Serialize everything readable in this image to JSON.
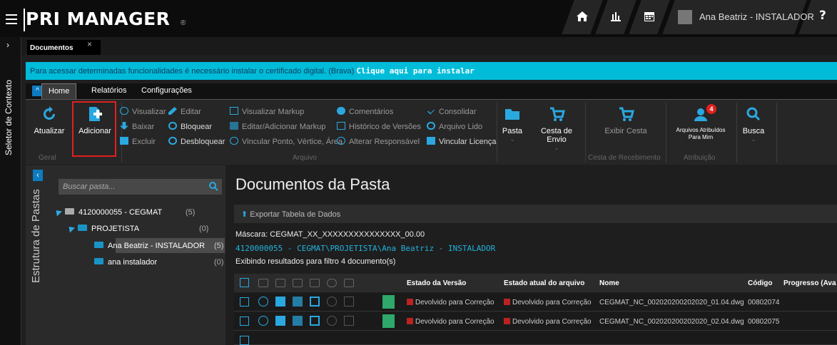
{
  "app": {
    "logo": "PRI MANAGER",
    "reg_mark": "®",
    "user": "Ana Beatriz - INSTALADOR",
    "help": "?"
  },
  "rail": {
    "context_label": "Seletor de Contexto"
  },
  "tabs": [
    {
      "label": "Documentos",
      "close": "×"
    }
  ],
  "banner": {
    "text": "Para acessar determinadas funcionalidades é necessário instalar o certificado digital. (Brava)",
    "link": "Clique aqui para instalar"
  },
  "ribbon_tabs": [
    "Home",
    "Relatórios",
    "Configurações"
  ],
  "ribbon": {
    "refresh": "Atualizar",
    "add": "Adicionar",
    "group_geral": "Geral",
    "visualizar": "Visualizar",
    "baixar": "Baixar",
    "excluir": "Excluir",
    "editar": "Editar",
    "bloquear": "Bloquear",
    "desbloquear": "Desbloquear",
    "visualizar_markup": "Visualizar Markup",
    "editar_markup": "Editar/Adicionar Markup",
    "vincular_ponto": "Vincular Ponto, Vértice, Área",
    "comentarios": "Comentários",
    "historico": "Histórico de Versões",
    "alterar_resp": "Alterar Responsável",
    "consolidar": "Consolidar",
    "arquivo_lido": "Arquivo Lido",
    "vincular_licenca": "Vincular Licença",
    "group_arquivo": "Arquivo",
    "pasta": "Pasta",
    "cesta_envio": "Cesta de Envio",
    "exibir_cesta": "Exibir Cesta",
    "group_cesta": "Cesta de Recebimento",
    "arquivos_atribuidos": "Arquivos Atribuídos Para Mim",
    "badge": "4",
    "group_atrib": "Atribuição",
    "busca": "Busca"
  },
  "left_panel": {
    "title": "Estrutura de Pastas",
    "search_placeholder": "Buscar pasta...",
    "tree": [
      {
        "label": "4120000055 - CEGMAT",
        "count": "(5)"
      },
      {
        "label": "PROJETISTA",
        "count": "(0)"
      },
      {
        "label": "Ana Beatriz - INSTALADOR",
        "count": "(5)"
      },
      {
        "label": "ana instalador",
        "count": "(0)"
      }
    ]
  },
  "main": {
    "title": "Documentos da Pasta",
    "export": "Exportar Tabela de Dados",
    "mask": "Máscara: CEGMAT_XX_XXXXXXXXXXXXXXX_00.00",
    "path": "4120000055 - CEGMAT\\PROJETISTA\\Ana Beatriz - INSTALADOR",
    "filter": "Exibindo resultados para filtro  4 documento(s)",
    "columns": [
      "Estado da Versão",
      "Estado atual do arquivo",
      "Nome",
      "Código",
      "Progresso (Ava"
    ],
    "rows": [
      {
        "estado_versao": "Devolvido para Correção",
        "estado_atual": "Devolvido para Correção",
        "nome": "CEGMAT_NC_002020200202020_01.04.dwg",
        "codigo": "00802074"
      },
      {
        "estado_versao": "Devolvido para Correção",
        "estado_atual": "Devolvido para Correção",
        "nome": "CEGMAT_NC_002020200202020_02.04.dwg",
        "codigo": "00802075"
      }
    ]
  },
  "colors": {
    "accent": "#00bcd9",
    "highlight": "#e02020",
    "blue": "#2aa8e0",
    "status": "#b22222"
  }
}
